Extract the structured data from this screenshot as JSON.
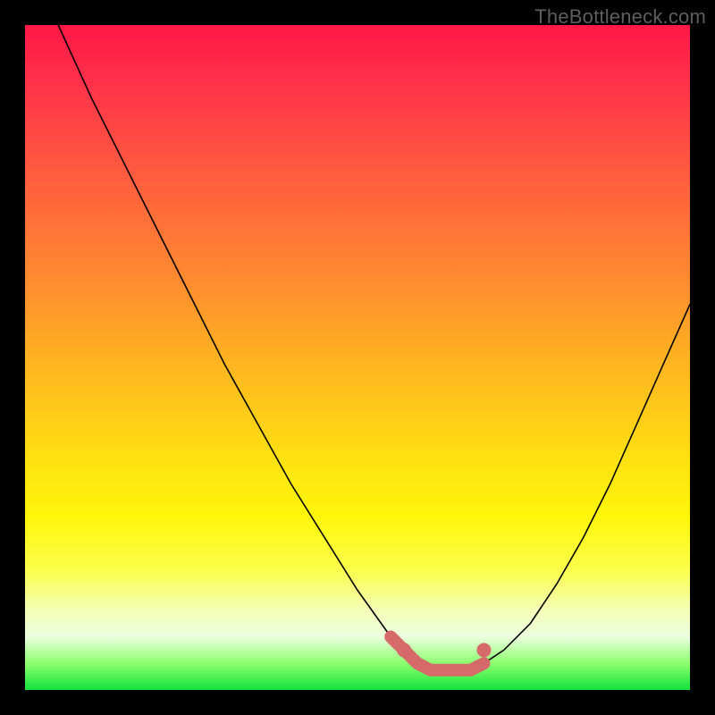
{
  "watermark": "TheBottleneck.com",
  "chart_data": {
    "type": "line",
    "title": "",
    "xlabel": "",
    "ylabel": "",
    "xlim": [
      0,
      100
    ],
    "ylim": [
      0,
      100
    ],
    "series": [
      {
        "name": "bottleneck-curve",
        "x": [
          5,
          10,
          15,
          20,
          25,
          30,
          35,
          40,
          45,
          50,
          55,
          57,
          59,
          61,
          63,
          65,
          67,
          69,
          72,
          76,
          80,
          84,
          88,
          92,
          96,
          100
        ],
        "y": [
          100,
          89,
          79,
          69,
          59,
          49,
          40,
          31,
          23,
          15,
          8,
          6,
          4,
          3,
          3,
          3,
          3,
          4,
          6,
          10,
          16,
          23,
          31,
          40,
          49,
          58
        ]
      }
    ],
    "markers": [
      {
        "name": "optimal-dot-left",
        "x": 57,
        "y": 6
      },
      {
        "name": "optimal-dot-right",
        "x": 69,
        "y": 6
      }
    ],
    "optimal_band": {
      "x_start": 55,
      "x_end": 70,
      "color": "#d66a6a"
    },
    "background_gradient": {
      "stops": [
        {
          "pos": 0,
          "color": "#ff1846"
        },
        {
          "pos": 22,
          "color": "#ff5a3f"
        },
        {
          "pos": 52,
          "color": "#ffb81f"
        },
        {
          "pos": 74,
          "color": "#fff60a"
        },
        {
          "pos": 92,
          "color": "#ecffdf"
        },
        {
          "pos": 100,
          "color": "#14e23c"
        }
      ]
    }
  }
}
